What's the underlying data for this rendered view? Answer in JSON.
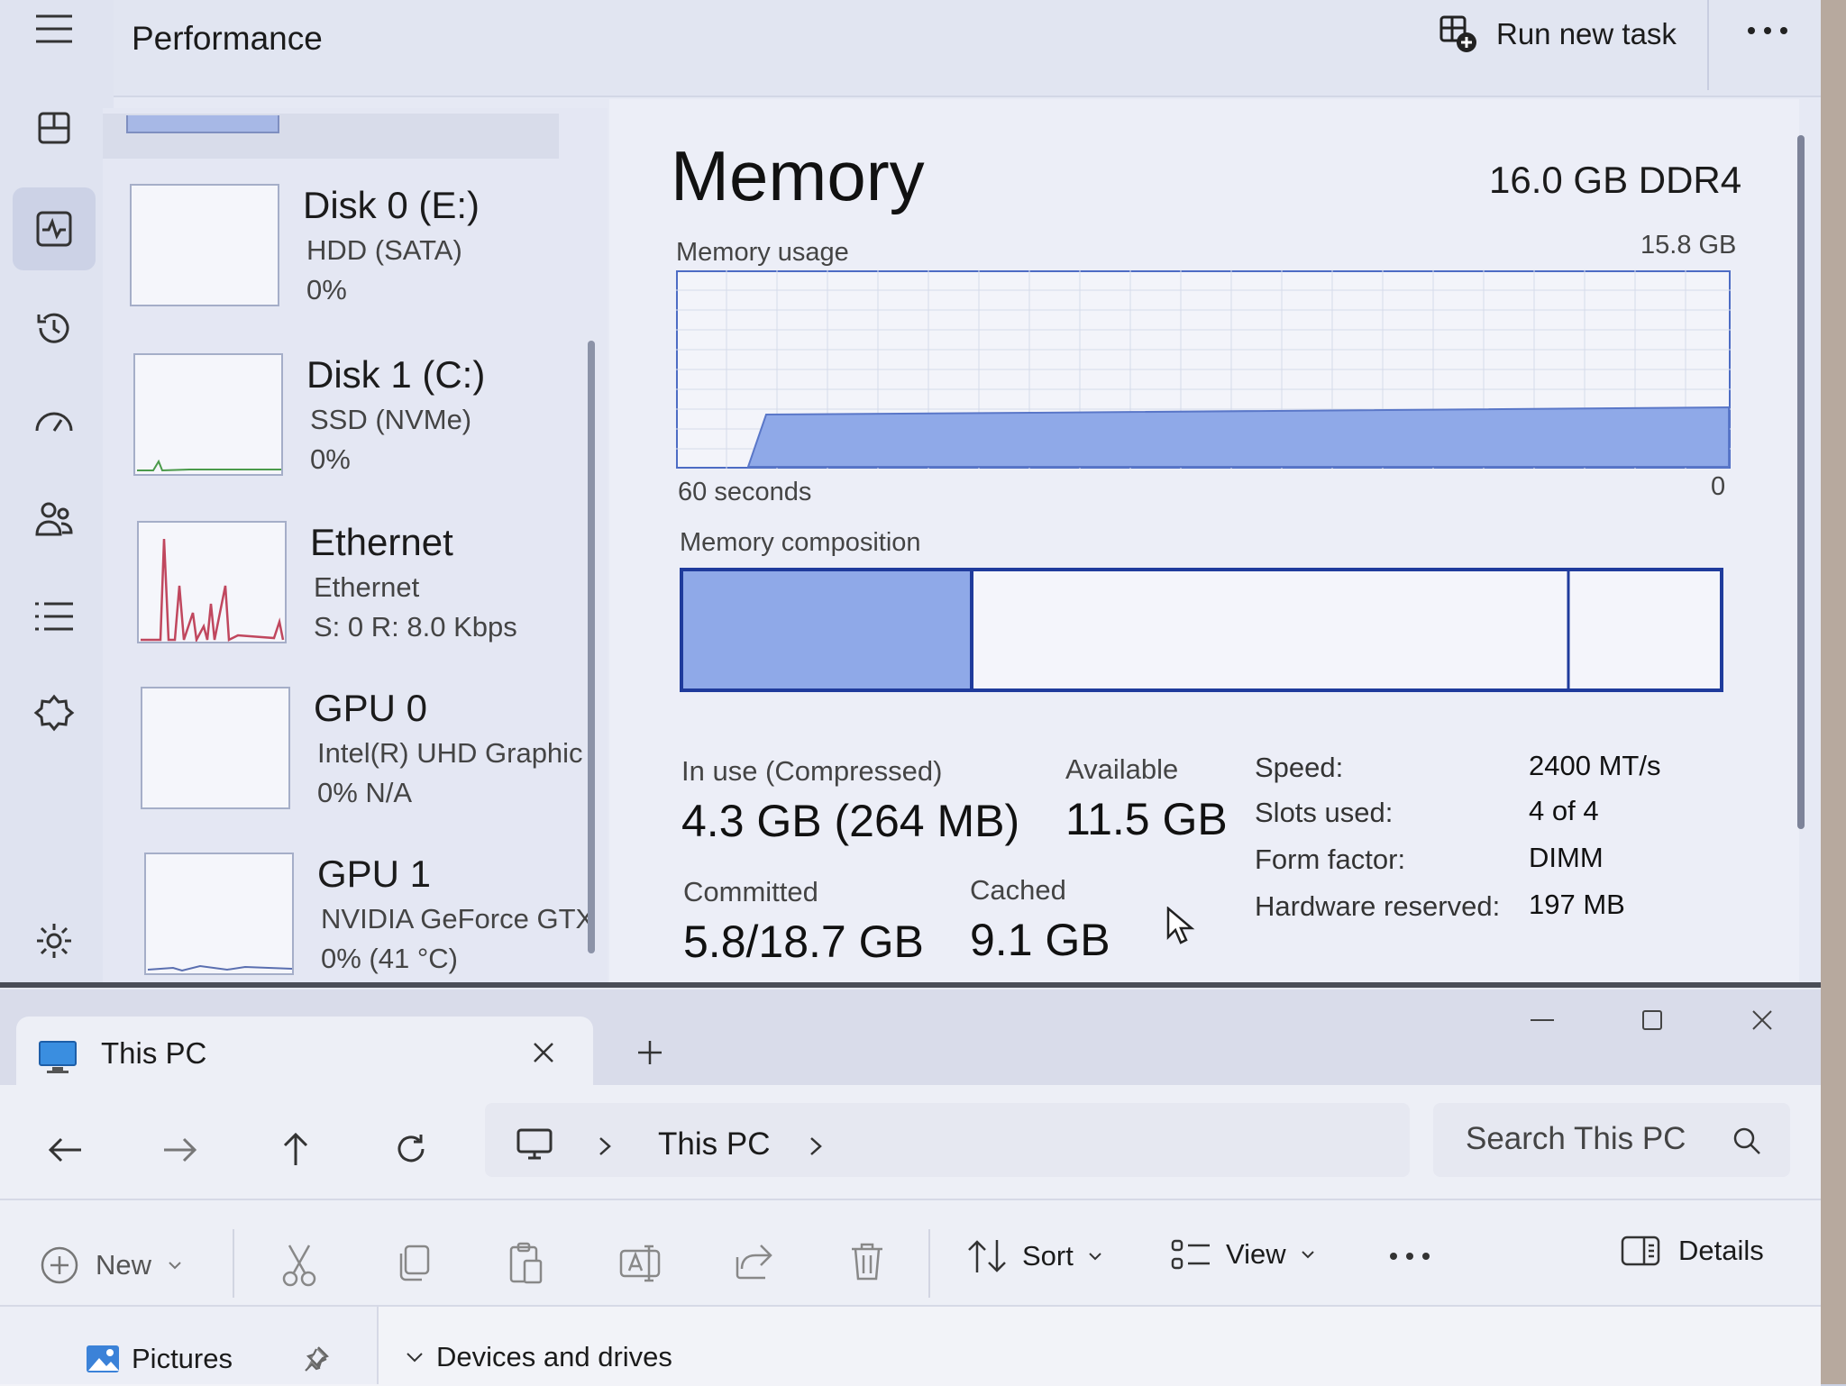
{
  "task_manager": {
    "page_title": "Performance",
    "run_new_task_label": "Run new task",
    "more_label": "•••",
    "rail_icons": [
      "hamburger-menu-icon",
      "processes-icon",
      "performance-icon",
      "app-history-icon",
      "startup-apps-icon",
      "users-icon",
      "details-icon",
      "services-icon",
      "settings-icon"
    ],
    "devices": [
      {
        "name": "Disk 0 (E:)",
        "sub1": "HDD (SATA)",
        "sub2": "0%"
      },
      {
        "name": "Disk 1 (C:)",
        "sub1": "SSD (NVMe)",
        "sub2": "0%"
      },
      {
        "name": "Ethernet",
        "sub1": "Ethernet",
        "sub2": "S: 0 R: 8.0 Kbps"
      },
      {
        "name": "GPU 0",
        "sub1": "Intel(R) UHD Graphic",
        "sub2": "0%  N/A"
      },
      {
        "name": "GPU 1",
        "sub1": "NVIDIA GeForce GTX",
        "sub2": "0%  (41 °C)"
      }
    ],
    "memory": {
      "title": "Memory",
      "total": "16.0 GB DDR4",
      "usage_label": "Memory usage",
      "usage_max": "15.8 GB",
      "axis_left": "60 seconds",
      "axis_right": "0",
      "composition_label": "Memory composition",
      "stats": {
        "in_use_label": "In use (Compressed)",
        "in_use_value": "4.3 GB (264 MB)",
        "available_label": "Available",
        "available_value": "11.5 GB",
        "committed_label": "Committed",
        "committed_value": "5.8/18.7 GB",
        "cached_label": "Cached",
        "cached_value": "9.1 GB"
      },
      "specs": [
        {
          "key": "Speed:",
          "value": "2400 MT/s"
        },
        {
          "key": "Slots used:",
          "value": "4 of 4"
        },
        {
          "key": "Form factor:",
          "value": "DIMM"
        },
        {
          "key": "Hardware reserved:",
          "value": "197 MB"
        }
      ]
    },
    "colors": {
      "accent": "#8fa9e8",
      "accent_border": "#1f3b9c",
      "ethernet_line": "#c0475e"
    }
  },
  "file_explorer": {
    "tab_title": "This PC",
    "breadcrumb": "This PC",
    "search_placeholder": "Search This PC",
    "commands": {
      "new_label": "New",
      "sort_label": "Sort",
      "view_label": "View",
      "more_label": "•••",
      "details_label": "Details"
    },
    "sidebar_item": "Pictures",
    "section_header": "Devices and drives"
  }
}
